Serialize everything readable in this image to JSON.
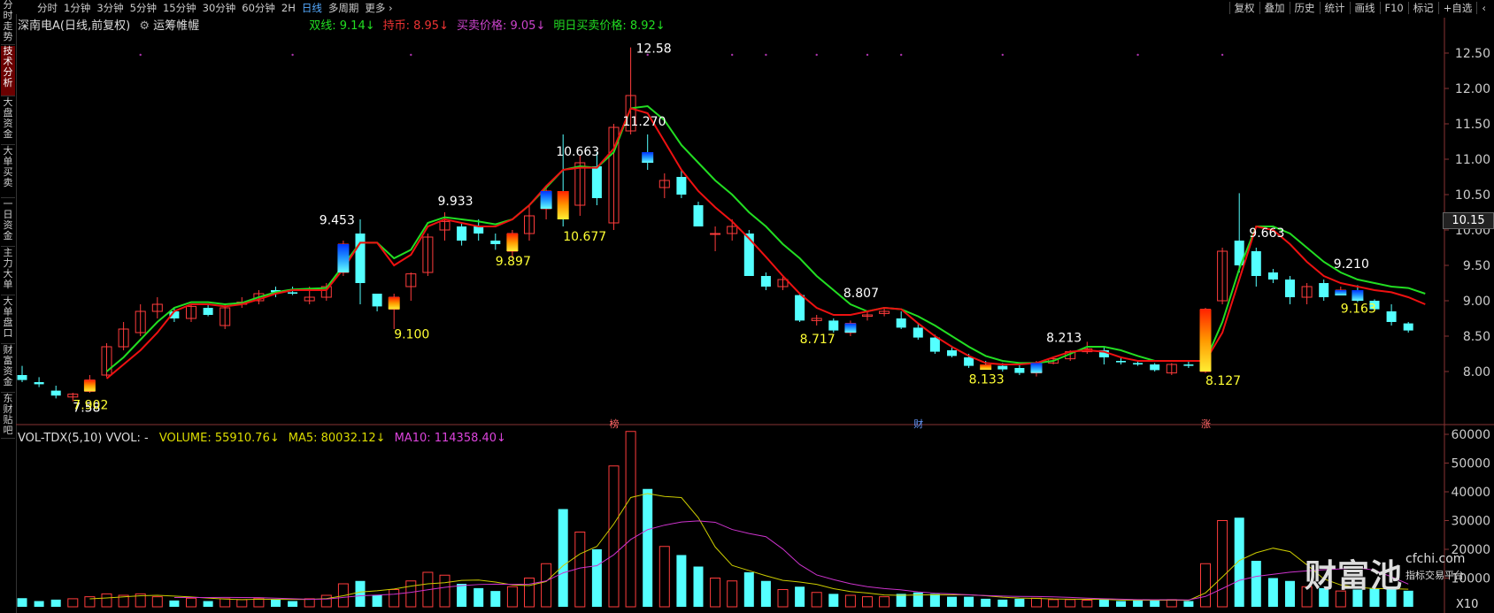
{
  "sidebar": {
    "tabs": [
      "分时走势",
      "技术分析",
      "大盘资金",
      "大单买卖",
      "一日资金",
      "主力大单",
      "大单盘口",
      "财富资金",
      "东财贴吧"
    ],
    "active_index": 1
  },
  "toolbar": {
    "periods": [
      "分时",
      "1分钟",
      "3分钟",
      "5分钟",
      "15分钟",
      "30分钟",
      "60分钟",
      "2H",
      "日线",
      "多周期",
      "更多 ›"
    ],
    "active_period": "日线",
    "right_buttons": [
      "复权",
      "叠加",
      "历史",
      "统计",
      "画线",
      "F10",
      "标记",
      "+自选"
    ],
    "back_symbol": "‹"
  },
  "main_panel": {
    "stock_title": "深南电A(日线,前复权)",
    "indicator_name": "运筹帷幄",
    "indicator_gear": "⚙",
    "indicators": [
      {
        "label": "双线: 9.14↓",
        "color": "#22dd22"
      },
      {
        "label": "持币: 8.95↓",
        "color": "#ee3333"
      },
      {
        "label": "买卖价格: 9.05↓",
        "color": "#cc44cc"
      },
      {
        "label": "明日买卖价格: 8.92↓",
        "color": "#22dd22"
      }
    ],
    "current_price": "10.15",
    "annotations": [
      {
        "text": "7.58",
        "color": "#ffffff"
      },
      {
        "text": "7.902",
        "color": "#ffff33"
      },
      {
        "text": "9.453",
        "color": "#ffffff"
      },
      {
        "text": "9.100",
        "color": "#ffff33"
      },
      {
        "text": "9.933",
        "color": "#ffffff"
      },
      {
        "text": "9.897",
        "color": "#ffff33"
      },
      {
        "text": "10.663",
        "color": "#ffffff"
      },
      {
        "text": "10.677",
        "color": "#ffff33"
      },
      {
        "text": "12.58",
        "color": "#ffffff"
      },
      {
        "text": "11.270",
        "color": "#ffffff"
      },
      {
        "text": "8.807",
        "color": "#ffffff"
      },
      {
        "text": "8.717",
        "color": "#ffff33"
      },
      {
        "text": "8.133",
        "color": "#ffff33"
      },
      {
        "text": "8.213",
        "color": "#ffffff"
      },
      {
        "text": "8.127",
        "color": "#ffff33"
      },
      {
        "text": "9.663",
        "color": "#ffffff"
      },
      {
        "text": "9.210",
        "color": "#ffffff"
      },
      {
        "text": "9.163",
        "color": "#ffff33"
      }
    ],
    "event_markers": [
      {
        "text": "榜",
        "color": "#ff6666"
      },
      {
        "text": "财",
        "color": "#6699ff"
      },
      {
        "text": "涨",
        "color": "#ff6666"
      }
    ]
  },
  "volume_panel": {
    "name": "VOL-TDX(5,10) VVOL: -",
    "items": [
      {
        "label": "VOLUME: 55910.76↓",
        "color": "#dddd00"
      },
      {
        "label": "MA5: 80032.12↓",
        "color": "#dddd00"
      },
      {
        "label": "MA10: 114358.40↓",
        "color": "#dd44dd"
      }
    ],
    "multiplier": "X10"
  },
  "watermark": {
    "main": "财富池",
    "domain": "cfchi.com",
    "sub": "指标交易平台"
  },
  "chart_data": {
    "type": "candlestick",
    "price_axis": {
      "ticks": [
        8.0,
        8.5,
        9.0,
        9.5,
        10.0,
        10.5,
        11.0,
        11.5,
        12.0,
        12.5
      ],
      "ylim": [
        7.4,
        12.75
      ]
    },
    "volume_axis": {
      "ticks": [
        10000,
        20000,
        30000,
        40000,
        50000,
        60000
      ],
      "ylim": [
        0,
        64000
      ]
    },
    "colors": {
      "up": "#ff3c3c",
      "down": "#54ffff",
      "ma5": "#cccc00",
      "ma10": "#cc33cc",
      "line_green": "#22dd22",
      "line_red": "#ee1111"
    },
    "candles": [
      {
        "o": 7.95,
        "h": 8.08,
        "l": 7.85,
        "c": 7.88,
        "v": 3000
      },
      {
        "o": 7.85,
        "h": 7.92,
        "l": 7.78,
        "c": 7.82,
        "v": 2000
      },
      {
        "o": 7.73,
        "h": 7.8,
        "l": 7.62,
        "c": 7.66,
        "v": 2500
      },
      {
        "o": 7.64,
        "h": 7.7,
        "l": 7.58,
        "c": 7.68,
        "v": 2800
      },
      {
        "o": 7.72,
        "h": 7.95,
        "l": 7.7,
        "c": 7.88,
        "v": 3500
      },
      {
        "o": 7.95,
        "h": 8.4,
        "l": 7.92,
        "c": 8.35,
        "v": 4500
      },
      {
        "o": 8.35,
        "h": 8.7,
        "l": 8.3,
        "c": 8.6,
        "v": 4000
      },
      {
        "o": 8.55,
        "h": 8.95,
        "l": 8.5,
        "c": 8.85,
        "v": 4500
      },
      {
        "o": 8.85,
        "h": 9.05,
        "l": 8.75,
        "c": 8.95,
        "v": 3500
      },
      {
        "o": 8.85,
        "h": 8.9,
        "l": 8.7,
        "c": 8.75,
        "v": 2200
      },
      {
        "o": 8.75,
        "h": 8.95,
        "l": 8.7,
        "c": 8.92,
        "v": 3000
      },
      {
        "o": 8.9,
        "h": 8.95,
        "l": 8.78,
        "c": 8.8,
        "v": 2000
      },
      {
        "o": 8.65,
        "h": 8.95,
        "l": 8.6,
        "c": 8.9,
        "v": 2800
      },
      {
        "o": 8.95,
        "h": 9.05,
        "l": 8.9,
        "c": 8.98,
        "v": 2500
      },
      {
        "o": 9.0,
        "h": 9.15,
        "l": 8.95,
        "c": 9.1,
        "v": 3000
      },
      {
        "o": 9.15,
        "h": 9.2,
        "l": 9.05,
        "c": 9.12,
        "v": 2500
      },
      {
        "o": 9.12,
        "h": 9.2,
        "l": 9.08,
        "c": 9.1,
        "v": 2000
      },
      {
        "o": 9.0,
        "h": 9.2,
        "l": 8.95,
        "c": 9.05,
        "v": 2800
      },
      {
        "o": 9.05,
        "h": 9.25,
        "l": 9.0,
        "c": 9.2,
        "v": 4000
      },
      {
        "o": 9.4,
        "h": 9.85,
        "l": 9.35,
        "c": 9.8,
        "v": 8000
      },
      {
        "o": 9.95,
        "h": 10.15,
        "l": 8.95,
        "c": 9.25,
        "v": 9000
      },
      {
        "o": 9.1,
        "h": 9.1,
        "l": 8.85,
        "c": 8.92,
        "v": 4000
      },
      {
        "o": 8.88,
        "h": 9.1,
        "l": 8.6,
        "c": 9.05,
        "v": 6000
      },
      {
        "o": 9.2,
        "h": 9.4,
        "l": 9.0,
        "c": 9.38,
        "v": 9000
      },
      {
        "o": 9.4,
        "h": 9.95,
        "l": 9.35,
        "c": 9.9,
        "v": 12000
      },
      {
        "o": 10.0,
        "h": 10.25,
        "l": 9.85,
        "c": 10.12,
        "v": 11000
      },
      {
        "o": 10.05,
        "h": 10.1,
        "l": 9.78,
        "c": 9.85,
        "v": 8000
      },
      {
        "o": 10.05,
        "h": 10.15,
        "l": 9.85,
        "c": 9.95,
        "v": 6500
      },
      {
        "o": 9.85,
        "h": 9.95,
        "l": 9.72,
        "c": 9.8,
        "v": 5500
      },
      {
        "o": 9.7,
        "h": 10.0,
        "l": 9.6,
        "c": 9.95,
        "v": 7000
      },
      {
        "o": 9.95,
        "h": 10.35,
        "l": 9.85,
        "c": 10.2,
        "v": 10000
      },
      {
        "o": 10.3,
        "h": 10.6,
        "l": 10.15,
        "c": 10.55,
        "v": 15000
      },
      {
        "o": 10.55,
        "h": 11.35,
        "l": 10.05,
        "c": 10.15,
        "v": 34000
      },
      {
        "o": 10.35,
        "h": 11.05,
        "l": 10.2,
        "c": 10.95,
        "v": 26000
      },
      {
        "o": 10.9,
        "h": 11.1,
        "l": 10.35,
        "c": 10.45,
        "v": 20000
      },
      {
        "o": 10.1,
        "h": 11.5,
        "l": 10.0,
        "c": 11.45,
        "v": 49000
      },
      {
        "o": 11.4,
        "h": 12.58,
        "l": 11.35,
        "c": 11.9,
        "v": 61000
      },
      {
        "o": 11.1,
        "h": 11.35,
        "l": 10.85,
        "c": 10.95,
        "v": 41000
      },
      {
        "o": 10.6,
        "h": 10.8,
        "l": 10.45,
        "c": 10.7,
        "v": 21000
      },
      {
        "o": 10.75,
        "h": 10.85,
        "l": 10.45,
        "c": 10.5,
        "v": 18000
      },
      {
        "o": 10.35,
        "h": 10.4,
        "l": 10.05,
        "c": 10.05,
        "v": 14000
      },
      {
        "o": 9.95,
        "h": 10.05,
        "l": 9.7,
        "c": 9.95,
        "v": 10000
      },
      {
        "o": 9.95,
        "h": 10.15,
        "l": 9.85,
        "c": 10.05,
        "v": 9000
      },
      {
        "o": 9.95,
        "h": 10.0,
        "l": 9.35,
        "c": 9.35,
        "v": 12000
      },
      {
        "o": 9.35,
        "h": 9.4,
        "l": 9.15,
        "c": 9.2,
        "v": 9000
      },
      {
        "o": 9.2,
        "h": 9.35,
        "l": 9.15,
        "c": 9.3,
        "v": 6000
      },
      {
        "o": 9.08,
        "h": 9.1,
        "l": 8.7,
        "c": 8.72,
        "v": 7000
      },
      {
        "o": 8.72,
        "h": 8.8,
        "l": 8.65,
        "c": 8.75,
        "v": 5000
      },
      {
        "o": 8.72,
        "h": 8.75,
        "l": 8.55,
        "c": 8.58,
        "v": 4500
      },
      {
        "o": 8.55,
        "h": 8.72,
        "l": 8.5,
        "c": 8.68,
        "v": 4000
      },
      {
        "o": 8.78,
        "h": 8.85,
        "l": 8.72,
        "c": 8.8,
        "v": 3500
      },
      {
        "o": 8.82,
        "h": 8.9,
        "l": 8.78,
        "c": 8.85,
        "v": 3500
      },
      {
        "o": 8.75,
        "h": 8.85,
        "l": 8.6,
        "c": 8.62,
        "v": 4500
      },
      {
        "o": 8.62,
        "h": 8.68,
        "l": 8.45,
        "c": 8.48,
        "v": 5000
      },
      {
        "o": 8.48,
        "h": 8.52,
        "l": 8.25,
        "c": 8.28,
        "v": 4500
      },
      {
        "o": 8.3,
        "h": 8.35,
        "l": 8.2,
        "c": 8.22,
        "v": 3500
      },
      {
        "o": 8.2,
        "h": 8.25,
        "l": 8.05,
        "c": 8.08,
        "v": 3500
      },
      {
        "o": 8.1,
        "h": 8.15,
        "l": 8.05,
        "c": 8.06,
        "v": 2800
      },
      {
        "o": 8.08,
        "h": 8.12,
        "l": 8.0,
        "c": 8.03,
        "v": 2500
      },
      {
        "o": 8.05,
        "h": 8.1,
        "l": 7.95,
        "c": 7.98,
        "v": 2800
      },
      {
        "o": 7.98,
        "h": 8.15,
        "l": 7.93,
        "c": 8.12,
        "v": 3000
      },
      {
        "o": 8.12,
        "h": 8.2,
        "l": 8.1,
        "c": 8.18,
        "v": 2500
      },
      {
        "o": 8.18,
        "h": 8.3,
        "l": 8.15,
        "c": 8.28,
        "v": 2500
      },
      {
        "o": 8.28,
        "h": 8.42,
        "l": 8.25,
        "c": 8.32,
        "v": 2300
      },
      {
        "o": 8.3,
        "h": 8.35,
        "l": 8.1,
        "c": 8.2,
        "v": 2500
      },
      {
        "o": 8.15,
        "h": 8.2,
        "l": 8.1,
        "c": 8.13,
        "v": 2000
      },
      {
        "o": 8.12,
        "h": 8.15,
        "l": 8.08,
        "c": 8.1,
        "v": 2200
      },
      {
        "o": 8.1,
        "h": 8.12,
        "l": 8.0,
        "c": 8.02,
        "v": 2500
      },
      {
        "o": 7.98,
        "h": 8.12,
        "l": 7.95,
        "c": 8.1,
        "v": 2500
      },
      {
        "o": 8.1,
        "h": 8.15,
        "l": 8.05,
        "c": 8.08,
        "v": 2000
      },
      {
        "o": 8.0,
        "h": 8.9,
        "l": 7.98,
        "c": 8.88,
        "v": 15000
      },
      {
        "o": 9.0,
        "h": 9.75,
        "l": 8.95,
        "c": 9.7,
        "v": 30000
      },
      {
        "o": 9.85,
        "h": 10.52,
        "l": 9.4,
        "c": 9.5,
        "v": 31000
      },
      {
        "o": 9.7,
        "h": 9.75,
        "l": 9.2,
        "c": 9.35,
        "v": 16000
      },
      {
        "o": 9.4,
        "h": 9.45,
        "l": 9.25,
        "c": 9.3,
        "v": 10000
      },
      {
        "o": 9.3,
        "h": 9.35,
        "l": 8.95,
        "c": 9.05,
        "v": 9000
      },
      {
        "o": 9.05,
        "h": 9.25,
        "l": 8.95,
        "c": 9.2,
        "v": 7000
      },
      {
        "o": 9.25,
        "h": 9.3,
        "l": 9.0,
        "c": 9.05,
        "v": 6500
      },
      {
        "o": 9.12,
        "h": 9.2,
        "l": 9.08,
        "c": 9.15,
        "v": 5500
      },
      {
        "o": 9.15,
        "h": 9.22,
        "l": 8.98,
        "c": 9.0,
        "v": 6000
      },
      {
        "o": 9.0,
        "h": 9.02,
        "l": 8.85,
        "c": 8.88,
        "v": 6500
      },
      {
        "o": 8.85,
        "h": 8.95,
        "l": 8.65,
        "c": 8.7,
        "v": 7000
      },
      {
        "o": 8.68,
        "h": 8.7,
        "l": 8.55,
        "c": 8.58,
        "v": 5600
      }
    ],
    "green_line": [
      null,
      null,
      null,
      null,
      null,
      8.0,
      8.2,
      8.45,
      8.7,
      8.9,
      8.98,
      8.98,
      8.95,
      8.97,
      9.05,
      9.12,
      9.16,
      9.17,
      9.18,
      9.5,
      9.82,
      9.82,
      9.6,
      9.72,
      10.1,
      10.18,
      10.15,
      10.12,
      10.08,
      10.15,
      10.35,
      10.6,
      10.85,
      10.9,
      10.88,
      11.1,
      11.72,
      11.75,
      11.55,
      11.2,
      10.95,
      10.7,
      10.5,
      10.25,
      10.05,
      9.8,
      9.6,
      9.35,
      9.15,
      8.95,
      8.85,
      8.9,
      8.88,
      8.78,
      8.65,
      8.5,
      8.35,
      8.22,
      8.15,
      8.12,
      8.12,
      8.15,
      8.25,
      8.35,
      8.35,
      8.3,
      8.22,
      8.15,
      8.15,
      8.15,
      8.15,
      8.7,
      9.45,
      10.05,
      10.05,
      9.95,
      9.75,
      9.55,
      9.4,
      9.3,
      9.25,
      9.2,
      9.18,
      9.1
    ],
    "red_line": [
      null,
      null,
      null,
      null,
      null,
      7.9,
      8.1,
      8.3,
      8.55,
      8.85,
      8.95,
      8.95,
      8.92,
      8.95,
      9.02,
      9.1,
      9.15,
      9.15,
      9.15,
      9.45,
      9.82,
      9.82,
      9.5,
      9.65,
      10.05,
      10.15,
      10.1,
      10.05,
      10.05,
      10.15,
      10.35,
      10.62,
      10.85,
      10.88,
      10.88,
      11.15,
      11.72,
      11.65,
      11.25,
      10.85,
      10.55,
      10.32,
      10.12,
      9.88,
      9.62,
      9.35,
      9.1,
      8.9,
      8.8,
      8.8,
      8.85,
      8.9,
      8.88,
      8.68,
      8.5,
      8.35,
      8.22,
      8.12,
      8.1,
      8.1,
      8.12,
      8.2,
      8.28,
      8.3,
      8.28,
      8.2,
      8.15,
      8.15,
      8.15,
      8.15,
      8.15,
      8.55,
      9.3,
      10.05,
      10.0,
      9.8,
      9.55,
      9.35,
      9.25,
      9.2,
      9.15,
      9.12,
      9.05,
      8.95
    ]
  }
}
